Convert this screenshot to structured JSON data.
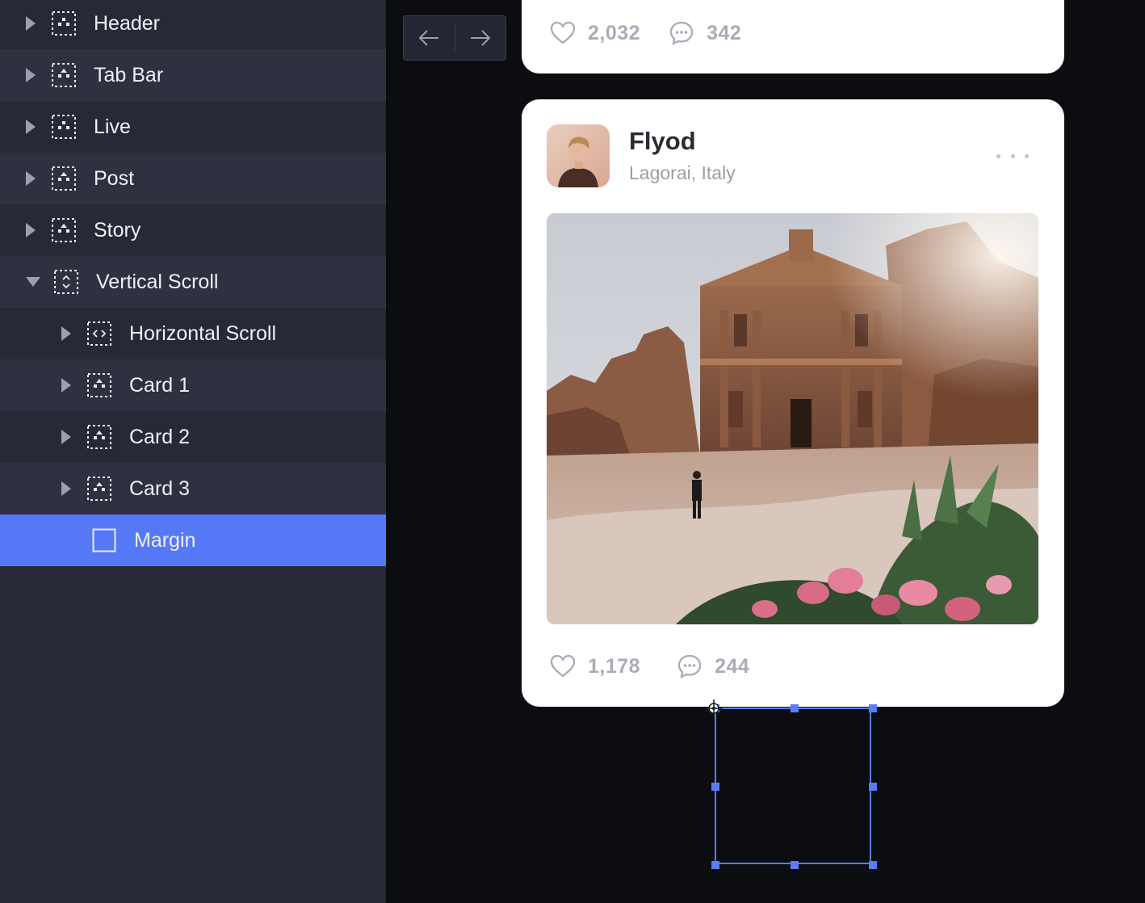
{
  "layers": {
    "items": [
      {
        "label": "Header",
        "icon": "frame-icon",
        "expanded": false
      },
      {
        "label": "Tab Bar",
        "icon": "frame-icon",
        "expanded": false
      },
      {
        "label": "Live",
        "icon": "frame-icon",
        "expanded": false
      },
      {
        "label": "Post",
        "icon": "frame-icon",
        "expanded": false
      },
      {
        "label": "Story",
        "icon": "frame-icon",
        "expanded": false
      },
      {
        "label": "Vertical Scroll",
        "icon": "vertical-scroll-frame-icon",
        "expanded": true
      },
      {
        "label": "Horizontal Scroll",
        "icon": "horizontal-scroll-frame-icon",
        "expanded": false
      },
      {
        "label": "Card 1",
        "icon": "frame-icon",
        "expanded": false
      },
      {
        "label": "Card 2",
        "icon": "frame-icon",
        "expanded": false
      },
      {
        "label": "Card 3",
        "icon": "frame-icon",
        "expanded": false
      },
      {
        "label": "Margin",
        "icon": "rectangle-icon",
        "selected": true
      }
    ]
  },
  "nav": {
    "back": "arrow-left-icon",
    "forward": "arrow-right-icon"
  },
  "top_card": {
    "likes": "2,032",
    "comments": "342"
  },
  "post": {
    "user_name": "Flyod",
    "location": "Lagorai, Italy",
    "likes": "1,178",
    "comments": "244"
  },
  "colors": {
    "panel": "#272a36",
    "panel_alt": "#2e3140",
    "selection": "#5578f6",
    "canvas": "#0b0d11"
  }
}
